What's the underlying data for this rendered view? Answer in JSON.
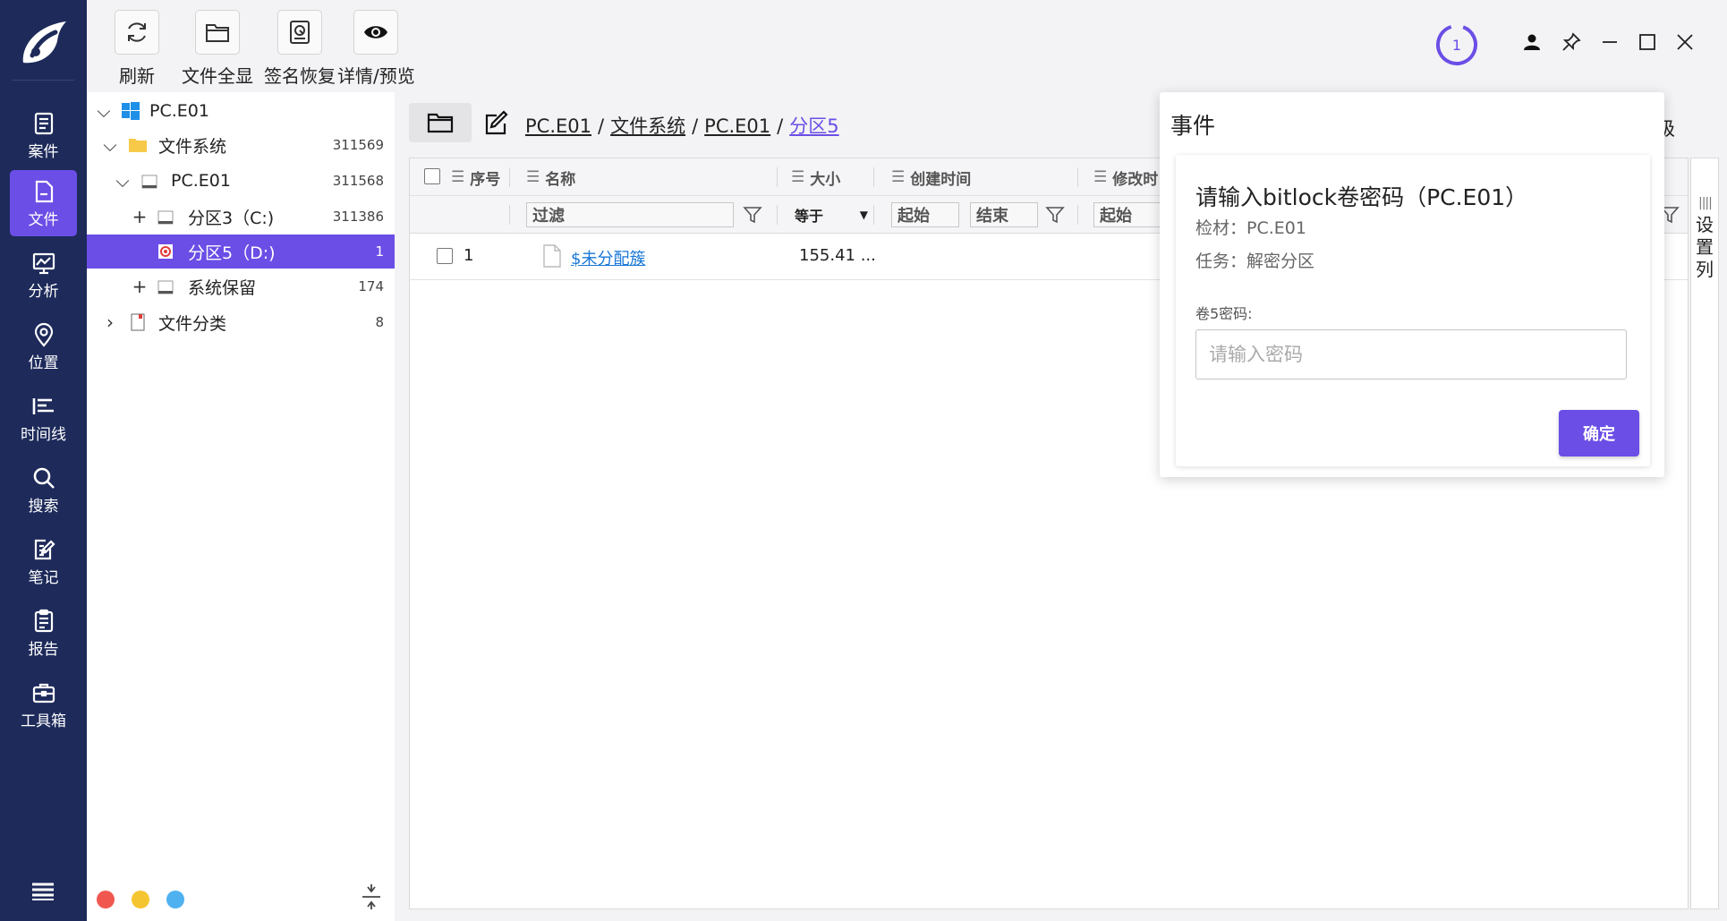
{
  "colors": {
    "nav_bg": "#1d2a5a",
    "accent": "#6b4ee6",
    "link": "#1a78d8"
  },
  "nav": {
    "items": [
      {
        "label": "案件",
        "icon": "case-icon"
      },
      {
        "label": "文件",
        "icon": "file-icon",
        "active": true
      },
      {
        "label": "分析",
        "icon": "analysis-icon"
      },
      {
        "label": "位置",
        "icon": "location-icon"
      },
      {
        "label": "时间线",
        "icon": "timeline-icon"
      },
      {
        "label": "搜索",
        "icon": "search-icon"
      },
      {
        "label": "笔记",
        "icon": "note-icon"
      },
      {
        "label": "报告",
        "icon": "report-icon"
      },
      {
        "label": "工具箱",
        "icon": "toolbox-icon"
      }
    ]
  },
  "toolbar": {
    "refresh": "刷新",
    "show_all": "文件全显",
    "signature_restore": "签名恢复",
    "details_preview": "详情/预览"
  },
  "progress": {
    "count": "1"
  },
  "tree": {
    "root": "PC.E01",
    "filesystem": {
      "label": "文件系统",
      "count": "311569"
    },
    "pce01": {
      "label": "PC.E01",
      "count": "311568"
    },
    "part3": {
      "label": "分区3（C:)",
      "count": "311386"
    },
    "part5": {
      "label": "分区5（D:)",
      "count": "1"
    },
    "reserved": {
      "label": "系统保留",
      "count": "174"
    },
    "classify": {
      "label": "文件分类",
      "count": "8"
    }
  },
  "breadcrumb": {
    "s1": "PC.E01",
    "s2": "文件系统",
    "s3": "PC.E01",
    "s4": "分区5",
    "sep": "/"
  },
  "advanced": "高级",
  "grid": {
    "headers": {
      "seq": "序号",
      "name": "名称",
      "size": "大小",
      "created": "创建时间",
      "modified": "修改时"
    },
    "filters": {
      "name": "过滤",
      "size": "等于",
      "created_start": "起始",
      "created_end": "结束",
      "modified_start": "起始"
    },
    "rows": [
      {
        "seq": "1",
        "name": "$未分配簇",
        "size": "155.41 ..."
      }
    ]
  },
  "settings_col": "设置列",
  "event": {
    "title": "事件",
    "card_title": "请输入bitlock卷密码（PC.E01）",
    "evidence": "检材：PC.E01",
    "task": "任务：解密分区",
    "field_label": "卷5密码:",
    "placeholder": "请输入密码",
    "confirm": "确定"
  }
}
